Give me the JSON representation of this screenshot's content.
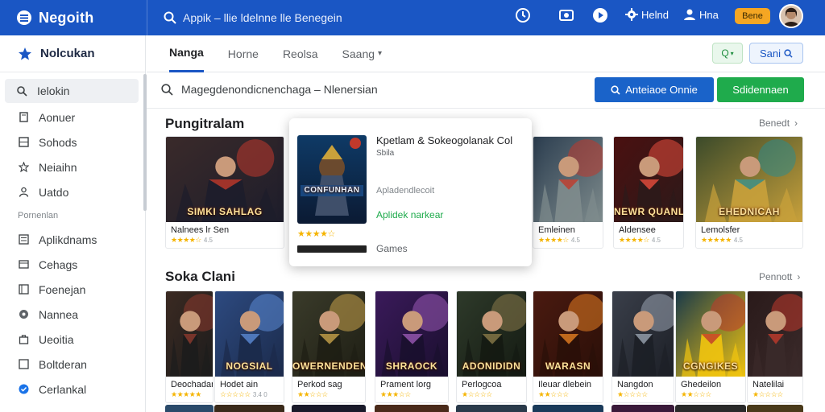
{
  "topbar": {
    "app_name": "Negoith",
    "search_text": "Appik – llie ldelnne lle Benegein",
    "icons": [
      "clock-icon",
      "camera-icon",
      "play-icon",
      "gear-icon",
      "user-icon"
    ],
    "user1": "Helnd",
    "user2": "Hna",
    "badge": "Bene"
  },
  "sidebar": {
    "header": "Nolcukan",
    "items_top": [
      {
        "label": "Ielokin",
        "icon": "search-icon"
      },
      {
        "label": "Aonuer",
        "icon": "book-icon"
      },
      {
        "label": "Sohods",
        "icon": "grid-icon"
      },
      {
        "label": "Neiaihn",
        "icon": "star-icon"
      },
      {
        "label": "Uatdo",
        "icon": "person-icon"
      }
    ],
    "section": "Pornenlan",
    "items_bottom": [
      {
        "label": "Aplikdnams",
        "icon": "list-icon"
      },
      {
        "label": "Cehags",
        "icon": "card-icon"
      },
      {
        "label": "Foenejan",
        "icon": "folder-icon"
      },
      {
        "label": "Nannea",
        "icon": "dot-icon"
      },
      {
        "label": "Ueoitia",
        "icon": "bag-icon"
      },
      {
        "label": "Boltderan",
        "icon": "box-icon"
      },
      {
        "label": "Cerlankal",
        "icon": "check-circle-icon"
      }
    ]
  },
  "tabs": [
    {
      "label": "Nanga"
    },
    {
      "label": "Horne"
    },
    {
      "label": "Reolsa"
    },
    {
      "label": "Saang"
    }
  ],
  "tab_buttons": {
    "search_small": "Q",
    "search_label": "Sani"
  },
  "search": {
    "text": "Magegdenondicnenchaga –  Nlenersian"
  },
  "actions": {
    "blue": "Anteiaoe Onnie",
    "green": "Sdidennaen"
  },
  "section1": {
    "title": "Pungitralam",
    "more": "Benedt",
    "cards": [
      {
        "title": "Nalnees lr Sen",
        "art_text": "SIMKI SAHLAG",
        "rating": 4,
        "count": "4.5",
        "colors": [
          "#3a2a2a",
          "#c0392b",
          "#1d1d2b"
        ]
      },
      {
        "title": "Emleinen",
        "art_text": "",
        "rating": 4,
        "count": "4.5",
        "colors": [
          "#2c3e50",
          "#c0392b",
          "#7f8c8d"
        ]
      },
      {
        "title": "Aldensee",
        "art_text": "NEWR QUANLAB",
        "rating": 4,
        "count": "4.5",
        "colors": [
          "#4a1010",
          "#e74c3c",
          "#2c1a1a"
        ]
      },
      {
        "title": "Lemolsfer",
        "art_text": "EHEDNICAH",
        "rating": 5,
        "count": "4.5",
        "colors": [
          "#3b4a2a",
          "#2e8b8b",
          "#c9a13b"
        ]
      }
    ]
  },
  "popup": {
    "title": "Kpetlam & Sokeogolanak Col",
    "subtitle": "Sbila",
    "description": "Apladendlecoit",
    "link": "Aplidek narkear",
    "category": "Games",
    "art_text": "CONFUNHAN",
    "rating": 4
  },
  "section2": {
    "title": "Soka Clani",
    "more": "Pennott",
    "cards": [
      {
        "title": "Deochadan",
        "art_text": "",
        "rating": 5,
        "count": "",
        "colors": [
          "#3b2a22",
          "#8e3b2e",
          "#1c1c1c"
        ]
      },
      {
        "title": "Hodet ain",
        "art_text": "NOGSIAL",
        "rating": 0,
        "count": "3.4 0",
        "colors": [
          "#2d4a80",
          "#5b8bd6",
          "#1b2a4a"
        ]
      },
      {
        "title": "Perkod sag",
        "art_text": "OWERNENDEN",
        "rating": 2,
        "count": "",
        "colors": [
          "#3a3b2a",
          "#c8a24a",
          "#1e1e14"
        ]
      },
      {
        "title": "Prament lorg",
        "art_text": "SHRAOCK",
        "rating": 3,
        "count": "",
        "colors": [
          "#3a1a5a",
          "#9b59b6",
          "#1a0f2e"
        ]
      },
      {
        "title": "Perlogcoa",
        "art_text": "ADONIDIDN",
        "rating": 1,
        "count": "",
        "colors": [
          "#2e3a2a",
          "#8a7a4a",
          "#141a12"
        ]
      },
      {
        "title": "Ileuar dlebein",
        "art_text": "WARASN",
        "rating": 2,
        "count": "",
        "colors": [
          "#4a1a10",
          "#e67e22",
          "#2a0f08"
        ]
      },
      {
        "title": "Nangdon",
        "art_text": "",
        "rating": 1,
        "count": "",
        "colors": [
          "#3a3f4a",
          "#9aa4b2",
          "#1c1f26"
        ]
      },
      {
        "title": "Ghedeilon",
        "art_text": "CGNGIKES",
        "rating": 2,
        "count": "",
        "colors": [
          "#1a3a4a",
          "#c0392b",
          "#f1c40f"
        ]
      },
      {
        "title": "Natelilai",
        "art_text": "",
        "rating": 1,
        "count": "",
        "colors": [
          "#2a1a1a",
          "#c0392b",
          "#3a2a2a"
        ]
      }
    ]
  },
  "colors": {
    "brand_blue": "#1a56c4",
    "action_green": "#1fab4c",
    "badge_orange": "#f5a623",
    "star": "#f5b400"
  }
}
